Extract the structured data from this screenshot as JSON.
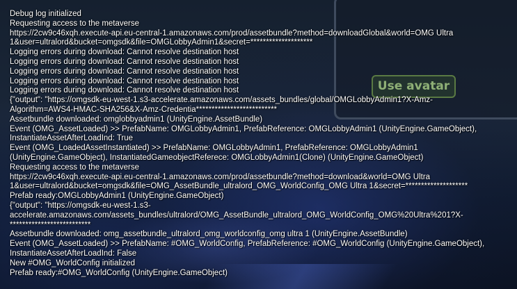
{
  "background": {
    "use_avatar_label": "Use avatar"
  },
  "log": {
    "lines": [
      "Debug log initialized",
      "Requesting access to the metaverse",
      "https://2cw9c46xqh.execute-api.eu-central-1.amazonaws.com/prod/assetbundle?method=downloadGlobal&world=OMG Ultra",
      "1&user=ultralord&bucket=omgsdk&file=OMGLobbyAdmin1&secret=********************",
      "Logging errors during download: Cannot resolve destination host",
      "Logging errors during download: Cannot resolve destination host",
      "Logging errors during download: Cannot resolve destination host",
      "Logging errors during download: Cannot resolve destination host",
      "Logging errors during download: Cannot resolve destination host",
      "{\"output\": \"https://omgsdk-eu-west-1.s3-accelerate.amazonaws.com/assets_bundles/global/OMGLobbyAdmin1?X-Amz-",
      "Algorithm=AWS4-HMAC-SHA256&X-Amz-Credentia**************************",
      "Assetbundle downloaded: omglobbyadmin1 (UnityEngine.AssetBundle)",
      "Event (OMG_AssetLoaded) >> PrefabName: OMGLobbyAdmin1, PrefabReference: OMGLobbyAdmin1 (UnityEngine.GameObject),",
      "InstantiateAssetAfterLoadInd: True",
      "Event (OMG_LoadedAssetInstantiated) >> PrefabName: OMGLobbyAdmin1, PrefabReference: OMGLobbyAdmin1",
      "(UnityEngine.GameObject), InstantiatedGameobjectReferece: OMGLobbyAdmin1(Clone) (UnityEngine.GameObject)",
      "Requesting access to the metaverse",
      "https://2cw9c46xqh.execute-api.eu-central-1.amazonaws.com/prod/assetbundle?method=download&world=OMG Ultra",
      "1&user=ultralord&bucket=omgsdk&file=OMG_AssetBundle_ultralord_OMG_WorldConfig_OMG Ultra 1&secret=********************",
      "Prefab ready:OMGLobbyAdmin1 (UnityEngine.GameObject)",
      "{\"output\": \"https://omgsdk-eu-west-1.s3-",
      "accelerate.amazonaws.com/assets_bundles/ultralord/OMG_AssetBundle_ultralord_OMG_WorldConfig_OMG%20Ultra%201?X-",
      "**************************",
      "Assetbundle downloaded: omg_assetbundle_ultralord_omg_worldconfig_omg ultra 1 (UnityEngine.AssetBundle)",
      "Event (OMG_AssetLoaded) >> PrefabName: #OMG_WorldConfig, PrefabReference: #OMG_WorldConfig (UnityEngine.GameObject),",
      "InstantiateAssetAfterLoadInd: False",
      "New #OMG_WorldConfig initialized",
      "Prefab ready:#OMG_WorldConfig (UnityEngine.GameObject)"
    ]
  }
}
